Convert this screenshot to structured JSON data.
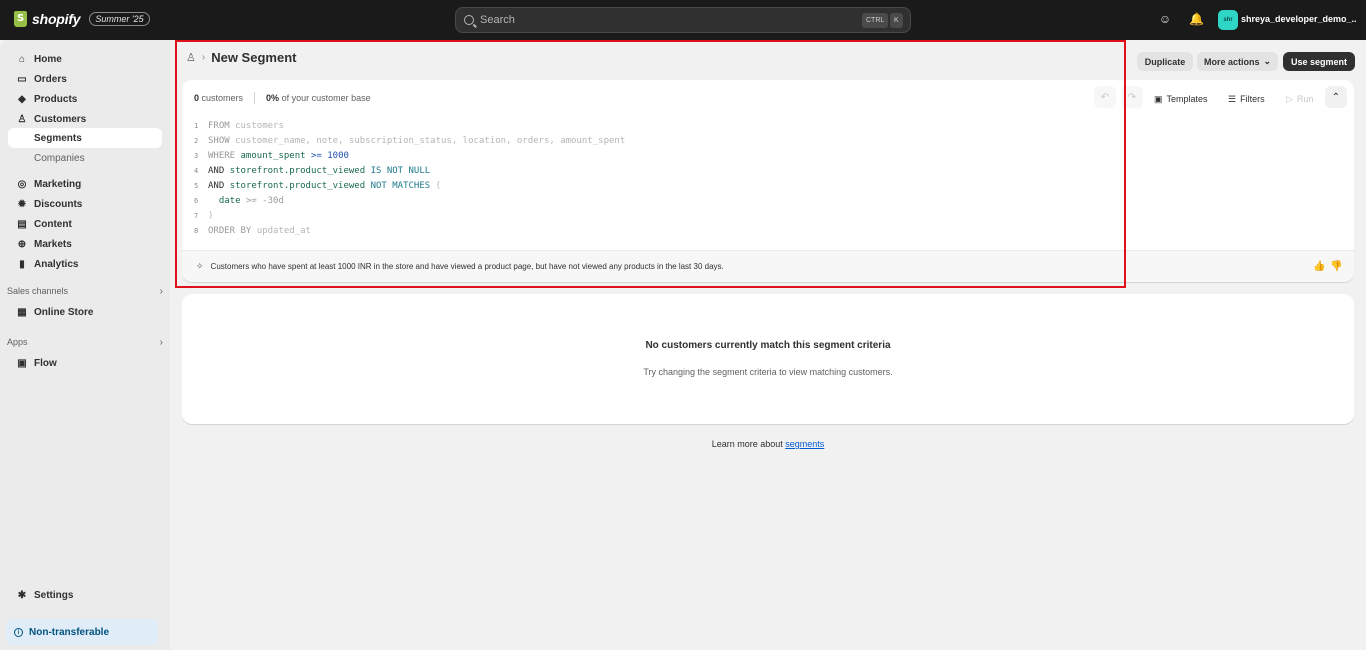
{
  "topbar": {
    "brand": "shopify",
    "edition": "Summer '25",
    "search_placeholder": "Search",
    "shortcut_mod": "CTRL",
    "shortcut_key": "K",
    "avatar_initials": "shr",
    "store_name": "shreya_developer_demo_..."
  },
  "sidebar": {
    "items": [
      {
        "label": "Home",
        "icon": "home-icon"
      },
      {
        "label": "Orders",
        "icon": "orders-icon"
      },
      {
        "label": "Products",
        "icon": "tag-icon"
      },
      {
        "label": "Customers",
        "icon": "person-icon"
      },
      {
        "label": "Segments",
        "icon": ""
      },
      {
        "label": "Companies",
        "icon": ""
      },
      {
        "label": "Marketing",
        "icon": "target-icon"
      },
      {
        "label": "Discounts",
        "icon": "discount-icon"
      },
      {
        "label": "Content",
        "icon": "content-icon"
      },
      {
        "label": "Markets",
        "icon": "globe-icon"
      },
      {
        "label": "Analytics",
        "icon": "bar-chart-icon"
      }
    ],
    "sales_channels_label": "Sales channels",
    "online_store": "Online Store",
    "apps_label": "Apps",
    "flow": "Flow",
    "settings": "Settings",
    "non_transferable": "Non-transferable"
  },
  "header": {
    "title": "New Segment",
    "duplicate": "Duplicate",
    "more_actions": "More actions",
    "use_segment": "Use segment"
  },
  "editor": {
    "customers_count": "0",
    "customers_label": "customers",
    "percent": "0%",
    "percent_label": "of your customer base",
    "templates": "Templates",
    "filters": "Filters",
    "run": "Run",
    "description": "Customers who have spent at least 1000 INR in the store and have viewed a product page, but have not viewed any products in the last 30 days.",
    "code": {
      "l1_kw": "FROM",
      "l1_val": "customers",
      "l2_kw": "SHOW",
      "l2_val": "customer_name, note, subscription_status, location, orders, amount_spent",
      "l3_kw": "WHERE",
      "l3_field": "amount_spent",
      "l3_op": ">=",
      "l3_num": "1000",
      "l4_kw": "AND",
      "l4_field": "storefront.product_viewed",
      "l4_op": "IS NOT NULL",
      "l5_kw": "AND",
      "l5_field": "storefront.product_viewed",
      "l5_op": "NOT MATCHES",
      "l5_paren": "(",
      "l6_field": "date",
      "l6_op": ">=",
      "l6_num": "-30d",
      "l7": ")",
      "l8_kw": "ORDER BY",
      "l8_val": "updated_at"
    }
  },
  "empty_state": {
    "title": "No customers currently match this segment criteria",
    "subtitle": "Try changing the segment criteria to view matching customers."
  },
  "learn_more": {
    "prefix": "Learn more about",
    "link": "segments"
  }
}
